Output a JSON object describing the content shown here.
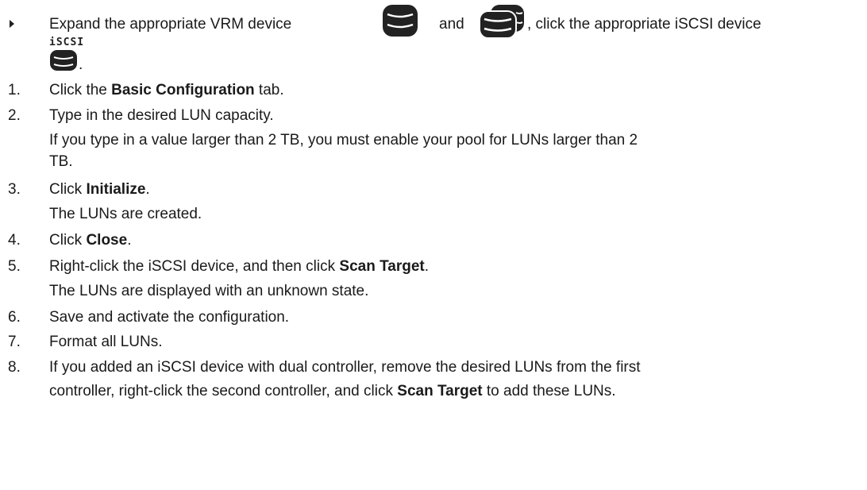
{
  "intro": {
    "text_1": "Expand the appropriate VRM device",
    "text_and": "and",
    "text_2": ", click the appropriate iSCSI device",
    "iscsi_label": "iSCSI",
    "period": "."
  },
  "steps": [
    {
      "number": "1.",
      "pre": "Click the ",
      "bold": "Basic Configuration",
      "post": " tab."
    },
    {
      "number": "2.",
      "text": "Type in the desired LUN capacity.",
      "note": "If you type in a value larger than 2 TB, you must enable your pool for LUNs larger than 2",
      "note_2": "TB."
    },
    {
      "number": "3.",
      "pre": "Click ",
      "bold": "Initialize",
      "post": ".",
      "note": "The LUNs are created."
    },
    {
      "number": "4.",
      "pre": "Click ",
      "bold": "Close",
      "post": "."
    },
    {
      "number": "5.",
      "pre": "Right-click the iSCSI device, and then click ",
      "bold": "Scan Target",
      "post": ".",
      "note": "The LUNs are displayed with an unknown state."
    },
    {
      "number": "6.",
      "text": "Save and activate the configuration."
    },
    {
      "number": "7.",
      "text": "Format all LUNs."
    },
    {
      "number": "8.",
      "text": "If you added an iSCSI device with dual controller, remove the desired LUNs from the first",
      "pre_2": "controller, right-click the second controller, and click ",
      "bold_2": "Scan Target",
      "post_2": " to add these LUNs."
    }
  ],
  "icons": {
    "vrm_device": "vrm-device-icon",
    "vrm_device_stack": "vrm-device-stack-icon",
    "iscsi_device": "iscsi-device-icon",
    "bullet": "triangle-bullet-icon"
  },
  "colors": {
    "text": "#1a1a1a",
    "icon_dark": "#222222",
    "icon_light": "#ffffff"
  }
}
